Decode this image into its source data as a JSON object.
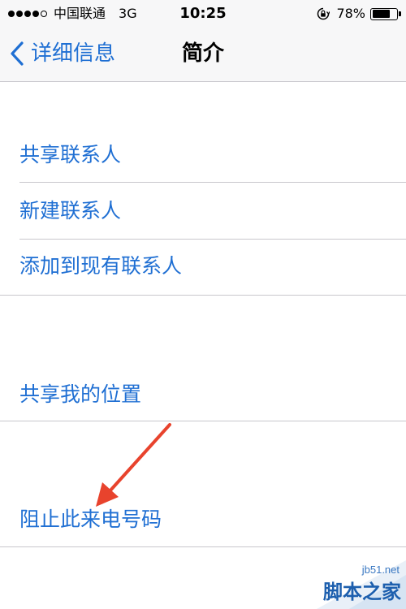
{
  "status_bar": {
    "carrier": "中国联通",
    "network": "3G",
    "time": "10:25",
    "battery_percent": "78%",
    "battery_level": 0.78
  },
  "nav": {
    "back_label": "详细信息",
    "title": "简介"
  },
  "cells": [
    {
      "label": "共享联系人"
    },
    {
      "label": "新建联系人"
    },
    {
      "label": "添加到现有联系人"
    },
    {
      "label": "共享我的位置"
    },
    {
      "label": "阻止此来电号码"
    }
  ],
  "annotation": {
    "arrow_color": "#e8432d"
  },
  "watermark": {
    "site": "jb51.net",
    "name": "脚本之家"
  },
  "colors": {
    "accent": "#1f6fd3",
    "separator": "#c8c7cc",
    "bar_background": "#f7f7f8"
  }
}
